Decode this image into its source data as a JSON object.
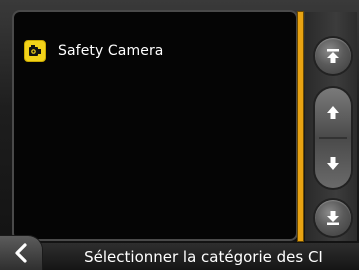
{
  "list": {
    "items": [
      {
        "label": "Safety Camera",
        "icon": "safety-camera-icon",
        "icon_color": "#f2d21a"
      }
    ]
  },
  "footer": {
    "title": "Sélectionner la catégorie des CI"
  },
  "scrollbar": {
    "accent_color": "#e8a312",
    "buttons": [
      "scroll-top-icon",
      "scroll-up-icon",
      "scroll-down-icon",
      "scroll-bottom-icon"
    ]
  }
}
